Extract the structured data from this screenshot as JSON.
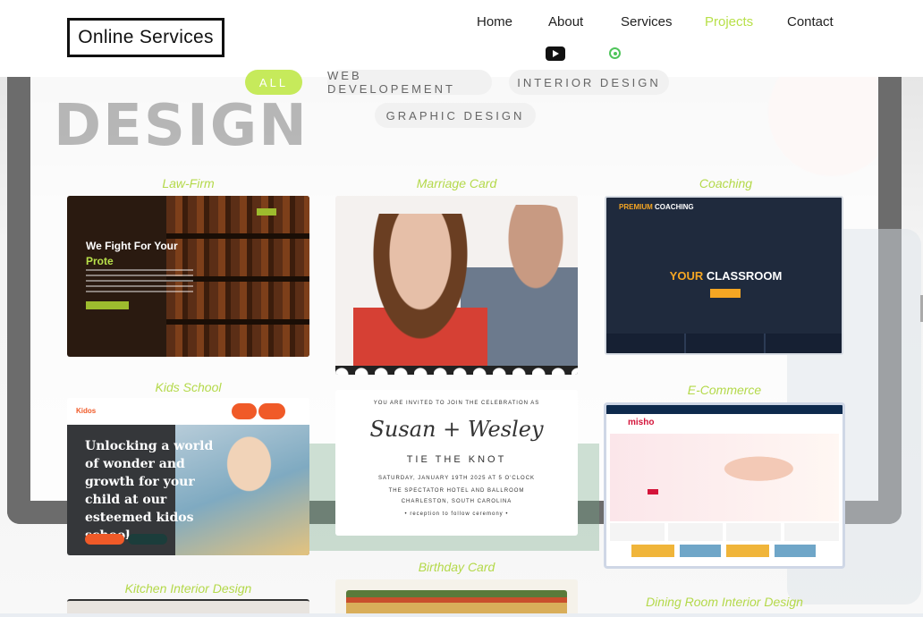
{
  "header": {
    "logo": "Online Services",
    "nav": [
      {
        "label": "Home",
        "active": false
      },
      {
        "label": "About",
        "active": false
      },
      {
        "label": "Services",
        "active": false
      },
      {
        "label": "Projects",
        "active": true
      },
      {
        "label": "Contact",
        "active": false
      }
    ],
    "social_icons": [
      "youtube-icon",
      "whatsapp-icon"
    ]
  },
  "filters": [
    {
      "label": "ALL",
      "active": true
    },
    {
      "label": "WEB DEVELOPEMENT",
      "active": false
    },
    {
      "label": "INTERIOR DESIGN",
      "active": false
    },
    {
      "label": "GRAPHIC DESIGN",
      "active": false
    }
  ],
  "projects": [
    {
      "caption": "Law-Firm",
      "headline_1": "We Fight For Your",
      "headline_2": "Prote"
    },
    {
      "caption": "Marriage Card"
    },
    {
      "caption": "Coaching",
      "brand_1": "PREMIUM",
      "brand_2": "COACHING",
      "big_1": "YOUR",
      "big_2": "CLASSROOM"
    },
    {
      "caption": "Kids School",
      "logo": "Kidos",
      "hero": "Unlocking a world of wonder and growth for your child at our esteemed kidos school"
    },
    {
      "caption": "E-Commerce",
      "logo": "misho"
    },
    {
      "caption": "Birthday Card"
    },
    {
      "caption": "Kitchen Interior Design"
    },
    {
      "caption": "Dining Room Interior Design"
    }
  ],
  "invitation": {
    "line1": "YOU ARE INVITED TO JOIN THE CELEBRATION AS",
    "names": "Susan + Wesley",
    "tie": "TIE THE KNOT",
    "date": "SATURDAY, JANUARY 19TH 2025 AT 5 O'CLOCK",
    "venue": "THE SPECTATOR HOTEL AND BALLROOM",
    "city": "CHARLESTON, SOUTH CAROLINA",
    "reception": "• reception to follow ceremony •"
  },
  "colors": {
    "accent": "#b8e04a",
    "chip_active": "#c6ea5b",
    "orange": "#f5a623"
  }
}
